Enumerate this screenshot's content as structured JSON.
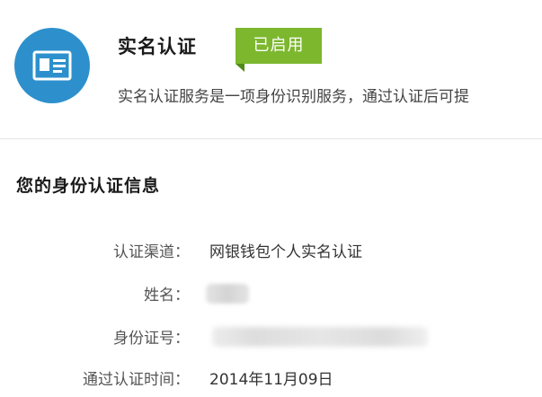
{
  "header": {
    "title": "实名认证",
    "status_badge": "已启用",
    "description": "实名认证服务是一项身份识别服务，通过认证后可提",
    "icon": "id-card-icon",
    "accent_color": "#2d90cc",
    "badge_color": "#7cb72e"
  },
  "section": {
    "title": "您的身份认证信息"
  },
  "info": {
    "channel": {
      "label": "认证渠道：",
      "value": "网银钱包个人实名认证"
    },
    "name": {
      "label": "姓名：",
      "value": ""
    },
    "id_number": {
      "label": "身份证号：",
      "value": ""
    },
    "verified_time": {
      "label": "通过认证时间：",
      "value": "2014年11月09日"
    }
  }
}
